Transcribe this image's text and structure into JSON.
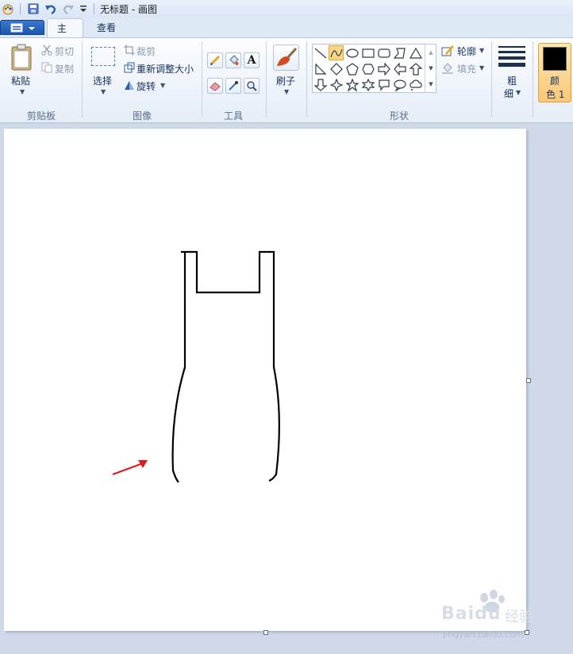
{
  "window": {
    "title": "无标题 - 画图"
  },
  "tabs": {
    "home": "主页",
    "view": "查看"
  },
  "ribbon": {
    "clipboard": {
      "paste": "粘贴",
      "cut": "剪切",
      "copy": "复制",
      "group_label": "剪贴板"
    },
    "image": {
      "select": "选择",
      "crop": "裁剪",
      "resize": "重新调整大小",
      "rotate": "旋转",
      "group_label": "图像"
    },
    "tools": {
      "group_label": "工具"
    },
    "brushes": {
      "label": "刷子"
    },
    "shapes": {
      "outline": "轮廓",
      "fill": "填充",
      "group_label": "形状"
    },
    "size": {
      "label_1": "粗",
      "label_2": "细"
    },
    "color1": {
      "label_1": "颜",
      "label_2": "色 1",
      "value": "#000000"
    }
  },
  "colors": {
    "accent": "#2b6bc8",
    "arrow": "#e0191b",
    "canvas": "#ffffff"
  },
  "watermark": {
    "brand": "Baidu",
    "product": "经验",
    "url": "jingyan.baidu.com"
  }
}
